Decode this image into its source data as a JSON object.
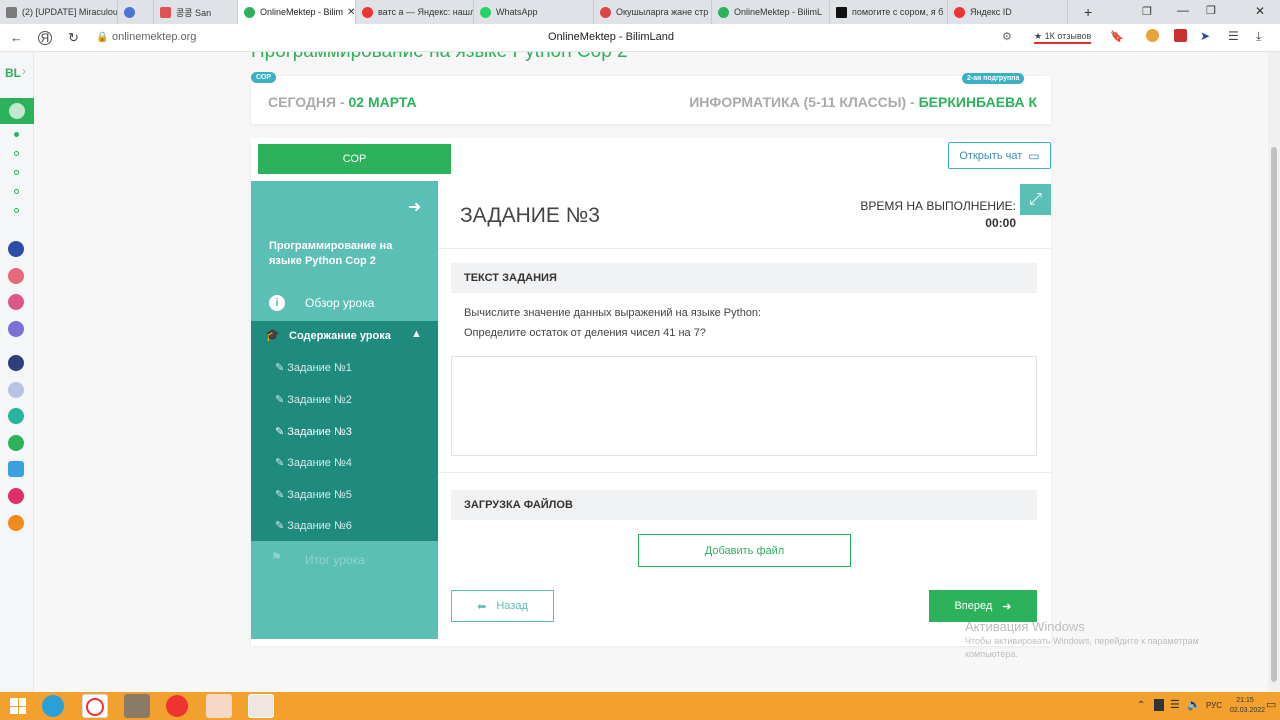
{
  "browser": {
    "tabs": [
      {
        "label": "(2) [UPDATE] Miraculou",
        "color": "#7a7a7a"
      },
      {
        "label": "",
        "color": "#4b73d6"
      },
      {
        "label": "콩콩 San",
        "color": "#e05252"
      },
      {
        "label": "OnlineMektep - Bilim",
        "color": "#2bb25a",
        "active": true
      },
      {
        "label": "ватс а — Яндекс: нашл",
        "color": "#e33"
      },
      {
        "label": "WhatsApp",
        "color": "#25d366"
      },
      {
        "label": "Окушыларга жане стр",
        "color": "#d44"
      },
      {
        "label": "OnlineMektep - BilimL",
        "color": "#2bb25a"
      },
      {
        "label": "помогите с сором, я б",
        "color": "#111"
      },
      {
        "label": "Яндекс ID",
        "color": "#e33"
      }
    ],
    "url": "onlinemektep.org",
    "page_title": "OnlineMektep - BilimLand",
    "reviews": "★ 1К отзывов"
  },
  "rail": {
    "logo": "BL"
  },
  "page": {
    "title": "Программирование на языке Python Сор 2",
    "badge_sor": "СОР",
    "badge_group": "2-ая подгруппа",
    "today_prefix": "СЕГОДНЯ - ",
    "today_date": "02 МАРТА",
    "subject": "ИНФОРМАТИКА (5-11 КЛАССЫ) - ",
    "teacher": "БЕРКИНБАЕВА К",
    "tab_sor": "СОР",
    "open_chat": "Открыть чат",
    "sidebar": {
      "course_title": "Программирование на языке Python Сор 2",
      "overview": "Обзор урока",
      "content": "Содержание урока",
      "tasks": [
        "Задание №1",
        "Задание №2",
        "Задание №3",
        "Задание №4",
        "Задание №5",
        "Задание №6"
      ],
      "summary": "Итог урока"
    },
    "task_heading": "ЗАДАНИЕ №3",
    "time_label": "ВРЕМЯ НА ВЫПОЛНЕНИЕ:",
    "time_value": "00:00",
    "text_section": "ТЕКСТ ЗАДАНИЯ",
    "question_line1": "Вычислите значение данных выражений на языке Python:",
    "question_line2": "Определите остаток от деления чисел 41 на 7?",
    "upload_section": "ЗАГРУЗКА ФАЙЛОВ",
    "add_file": "Добавить файл",
    "back": "Назад",
    "forward": "Вперед",
    "activate_title": "Активация Windows",
    "activate_text": "Чтобы активировать Windows, перейдите к параметрам компьютера."
  },
  "taskbar": {
    "lang": "РУС",
    "time": "21:15",
    "date": "02.03.2022"
  },
  "colors": {
    "green": "#2bb25a",
    "teal": "#5bbfb5",
    "dark_teal": "#1f8a7e",
    "taskbar": "#f2a02e"
  }
}
